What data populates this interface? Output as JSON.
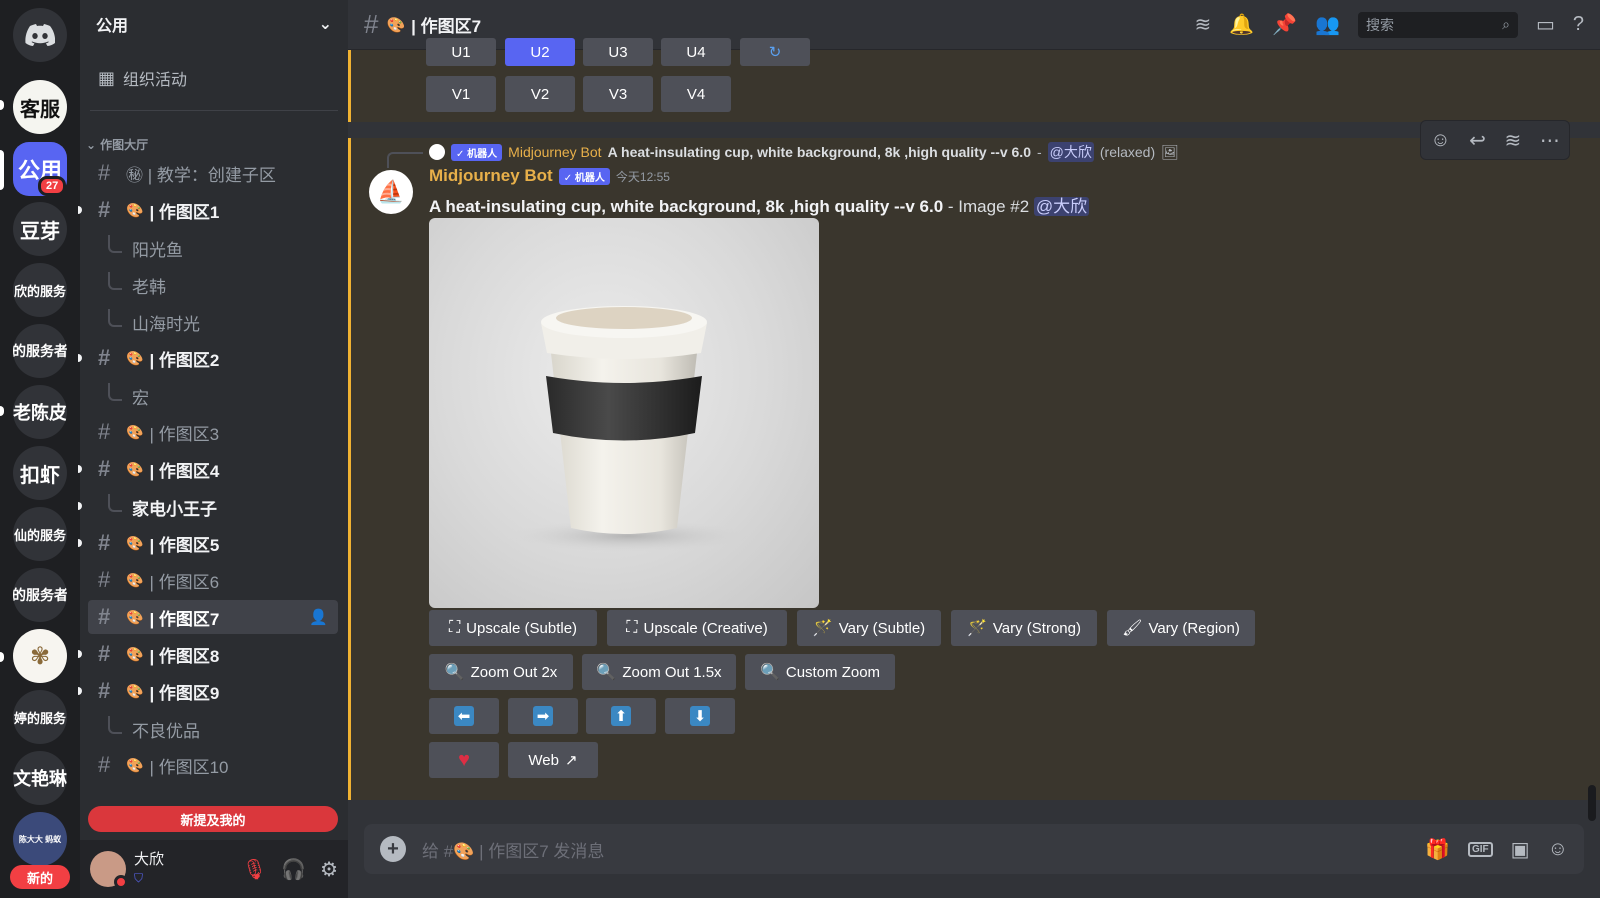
{
  "servers": [
    {
      "label": "",
      "icon": "discord-home-icon"
    },
    {
      "label": "客服"
    },
    {
      "label": "公用",
      "badge": "27"
    },
    {
      "label": "豆芽"
    },
    {
      "label": "欣的服务"
    },
    {
      "label": "的服务者"
    },
    {
      "label": "老陈皮"
    },
    {
      "label": "扣虾"
    },
    {
      "label": "仙的服务"
    },
    {
      "label": "的服务者"
    },
    {
      "label": "",
      "icon": "dandelion-icon"
    },
    {
      "label": "婷的服务"
    },
    {
      "label": "文艳琳"
    },
    {
      "label": "陈大大 蚂蚁"
    }
  ],
  "rail_new_label": "新的",
  "guild": {
    "name": "公用"
  },
  "sidebar": {
    "event_label": "组织活动",
    "category": "作图大厅",
    "channels": [
      {
        "label": "㊙ | 教学：创建子区",
        "type": "channel"
      },
      {
        "label": "| 作图区1",
        "type": "channel",
        "unread": true
      },
      {
        "label": "阳光鱼",
        "type": "thread"
      },
      {
        "label": "老韩",
        "type": "thread"
      },
      {
        "label": "山海时光",
        "type": "thread"
      },
      {
        "label": "| 作图区2",
        "type": "channel",
        "unread": true
      },
      {
        "label": "宏",
        "type": "thread"
      },
      {
        "label": "| 作图区3",
        "type": "channel"
      },
      {
        "label": "| 作图区4",
        "type": "channel",
        "unread": true
      },
      {
        "label": "家电小王子",
        "type": "thread",
        "unread": true
      },
      {
        "label": "| 作图区5",
        "type": "channel",
        "unread": true
      },
      {
        "label": "| 作图区6",
        "type": "channel"
      },
      {
        "label": "| 作图区7",
        "type": "channel",
        "selected": true
      },
      {
        "label": "| 作图区8",
        "type": "channel",
        "unread": true
      },
      {
        "label": "| 作图区9",
        "type": "channel",
        "unread": true
      },
      {
        "label": "不良优品",
        "type": "thread"
      },
      {
        "label": "| 作图区10",
        "type": "channel"
      }
    ],
    "new_mentions": "新提及我的"
  },
  "user": {
    "name": "大欣"
  },
  "channel": {
    "title": "| 作图区7",
    "emoji": "🎨"
  },
  "search": {
    "placeholder": "搜索"
  },
  "prev_message": {
    "upscale_buttons": [
      "U1",
      "U2",
      "U3",
      "U4"
    ],
    "vary_buttons": [
      "V1",
      "V2",
      "V3",
      "V4"
    ]
  },
  "message": {
    "reply_author": "Midjourney Bot",
    "reply_bot_tag": "✓ 机器人",
    "reply_text": "A heat-insulating cup, white background, 8k ,high quality --v 6.0",
    "reply_sep": "-",
    "reply_mention": "@大欣",
    "reply_suffix": "(relaxed)",
    "author": "Midjourney Bot",
    "bot_tag": "✓ 机器人",
    "time": "今天12:55",
    "prompt": "A heat-insulating cup, white background, 8k ,high quality --v 6.0",
    "image_suffix": "- Image #2",
    "mention": "@大欣"
  },
  "actions": {
    "upscale_subtle": "Upscale (Subtle)",
    "upscale_creative": "Upscale (Creative)",
    "vary_subtle": "Vary (Subtle)",
    "vary_strong": "Vary (Strong)",
    "vary_region": "Vary (Region)",
    "zoom_out_2x": "Zoom Out 2x",
    "zoom_out_15x": "Zoom Out 1.5x",
    "custom_zoom": "Custom Zoom",
    "web": "Web"
  },
  "composer": {
    "placeholder": "给 #🎨 | 作图区7 发消息"
  },
  "colors": {
    "accent": "#5865f2",
    "highlight_border": "#f0b232",
    "danger": "#f23f43",
    "bot_name": "#e8b04a"
  }
}
